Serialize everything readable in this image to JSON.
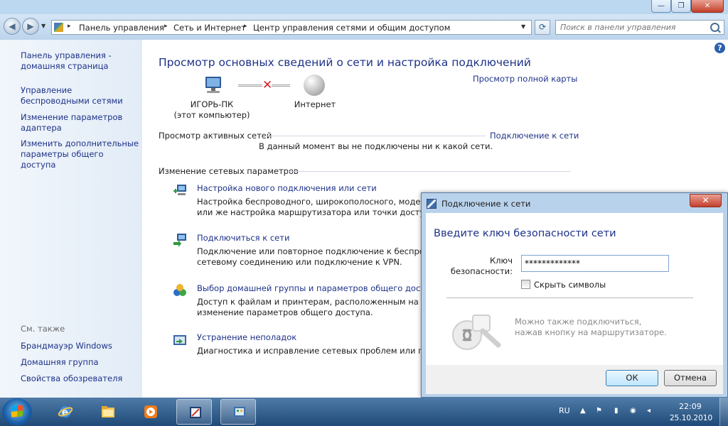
{
  "window": {
    "caption_buttons": {
      "minimize": "—",
      "maximize": "❐",
      "close": "✕"
    }
  },
  "address_bar": {
    "breadcrumbs": [
      "Панель управления",
      "Сеть и Интернет",
      "Центр управления сетями и общим доступом"
    ],
    "separator": "▸",
    "search_placeholder": "Поиск в панели управления"
  },
  "sidebar": {
    "home_link": "Панель управления - домашняя страница",
    "links": [
      "Управление беспроводными сетями",
      "Изменение параметров адаптера",
      "Изменить дополнительные параметры общего доступа"
    ],
    "see_also_title": "См. также",
    "see_also": [
      "Брандмауэр Windows",
      "Домашняя группа",
      "Свойства обозревателя"
    ]
  },
  "main": {
    "title": "Просмотр основных сведений о сети и настройка подключений",
    "full_map_link": "Просмотр полной карты",
    "computer_name": "ИГОРЬ-ПК",
    "computer_sub": "(этот компьютер)",
    "internet_label": "Интернет",
    "active_networks_heading": "Просмотр активных сетей",
    "connect_link": "Подключение к сети",
    "not_connected_text": "В данный момент вы не подключены ни к какой сети.",
    "change_settings_heading": "Изменение сетевых параметров",
    "tasks": [
      {
        "title": "Настройка нового подключения или сети",
        "desc1": "Настройка беспроводного, широкополосного, модемного",
        "desc2": "или же настройка маршрутизатора или точки доступа."
      },
      {
        "title": "Подключиться к сети",
        "desc1": "Подключение или повторное подключение к беспроводному",
        "desc2": "сетевому соединению или подключение к VPN."
      },
      {
        "title": "Выбор домашней группы и параметров общего доступа",
        "desc1": "Доступ к файлам и принтерам, расположенным на других",
        "desc2": "изменение параметров общего доступа."
      },
      {
        "title": "Устранение неполадок",
        "desc1": "Диагностика и исправление сетевых проблем или получение",
        "desc2": ""
      }
    ]
  },
  "dialog": {
    "title": "Подключение к сети",
    "heading": "Введите ключ безопасности сети",
    "key_label": "Ключ безопасности:",
    "key_value": "*************",
    "hide_chars_label": "Скрыть символы",
    "hide_chars_checked": false,
    "router_hint": "Можно также подключиться, нажав кнопку на маршрутизаторе.",
    "ok_label": "ОК",
    "cancel_label": "Отмена"
  },
  "taskbar": {
    "language": "RU",
    "time": "22:09",
    "date": "25.10.2010"
  },
  "colors": {
    "link": "#1e3287",
    "taskbar": "#1f4a78",
    "error_x": "#d4202a"
  }
}
